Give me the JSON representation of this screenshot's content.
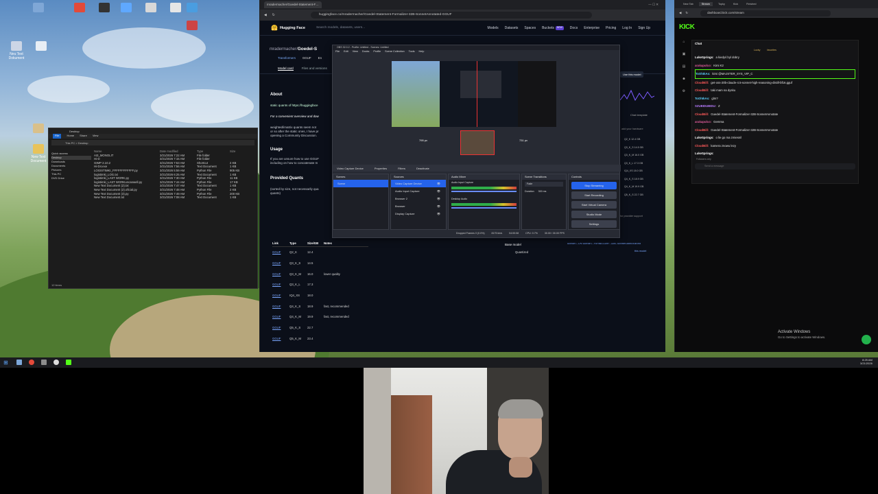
{
  "desktop": {
    "icons": [
      "Neu Text Dokument",
      "",
      "",
      "",
      "",
      "",
      "",
      "",
      "",
      "",
      "",
      "New Text Document",
      ""
    ],
    "explorer": {
      "title": "Desktop",
      "menu": [
        "File",
        "Home",
        "Share",
        "View"
      ],
      "breadcrumb": "This PC > Desktop",
      "sidebar": [
        "Quick access",
        "Desktop",
        "Downloads",
        "Documents",
        "Pictures",
        "This PC",
        "DVD Drive"
      ],
      "headers": [
        "Name",
        "Date modified",
        "Type",
        "Size"
      ],
      "files": [
        {
          "name": "AI3_MONOLIT",
          "date": "3/21/2026 7:22 AM",
          "type": "File folder",
          "size": ""
        },
        {
          "name": "Hi-D",
          "date": "3/21/2026 7:15 AM",
          "type": "File folder",
          "size": ""
        },
        {
          "name": "GIMP 2.10.2",
          "date": "3/21/2026 7:53 AM",
          "type": "Shortcut",
          "size": "2 KB"
        },
        {
          "name": "Hi-D4.exe",
          "date": "3/21/2026 7:56 AM",
          "type": "Text Document",
          "size": "1 KB"
        },
        {
          "name": "LOGISTIMKI_FFFFFFFFFFFF.py",
          "date": "3/21/2026 5:59 AM",
          "type": "Python File",
          "size": "905 KB"
        },
        {
          "name": "logistimki_LOG.txt",
          "date": "3/21/2026 6:25 AM",
          "type": "Text Document",
          "size": "1 KB"
        },
        {
          "name": "logistimki_LAST WORK.py",
          "date": "3/21/2026 7:30 AM",
          "type": "Python File",
          "size": "11 KB"
        },
        {
          "name": "logistimki_LAST WORKuncanwell.py",
          "date": "3/21/2026 7:44 AM",
          "type": "Python File",
          "size": "17 KB"
        },
        {
          "name": "New Text Document (2).txt",
          "date": "3/21/2026 7:47 AM",
          "type": "Text Document",
          "size": "1 KB"
        },
        {
          "name": "New Text Document (2).oficial.py",
          "date": "3/21/2026 7:48 AM",
          "type": "Python File",
          "size": "2 KB"
        },
        {
          "name": "New Text Document (3).py",
          "date": "3/21/2026 7:49 AM",
          "type": "Python File",
          "size": "200 KB"
        },
        {
          "name": "New Text Document.txt",
          "date": "3/21/2026 7:08 AM",
          "type": "Text Document",
          "size": "1 KB"
        }
      ],
      "status": "12 items"
    }
  },
  "browser": {
    "tab_title": "mradermacher/Goedel-Statement-Formalizer-32B-SonnetAnnotated-GGUF",
    "url": "huggingface.co/mradermacher/Goedel-Statement-Formalizer-32B-SonnetAnnotated-GGUF",
    "brand": "Hugging Face",
    "search_placeholder": "Search models, datasets, users...",
    "nav": [
      "Models",
      "Datasets",
      "Spaces",
      "Buckets",
      "Docs",
      "Enterprise",
      "Pricing",
      "Log In",
      "Sign Up"
    ],
    "buckets_badge": "NEW",
    "repo_owner": "mradermacher/",
    "repo_name": "Goedel-S",
    "tags": [
      "Transformers",
      "GGUF",
      "En"
    ],
    "tabs": [
      "Model card",
      "Files and versions"
    ],
    "about": "About",
    "about_text": "static quants of https://huggingface",
    "convenient": "For a convenient overview and dow",
    "weighted": "weighted/imatrix quants seem not",
    "weighted2": "or so after the static ones, I have pr",
    "weighted3": "opening a Community Discussion.",
    "usage": "Usage",
    "usage_text": "If you are unsure how to use GGUF",
    "usage_text2": "including on how to concatenate m",
    "provided": "Provided Quants",
    "sorted": "(sorted by size, not necessarily qua",
    "sorted2": "quants)",
    "table_headers": [
      "Link",
      "Type",
      "Size/GB",
      "Notes"
    ],
    "table": [
      {
        "link": "GGUF",
        "type": "Q2_K",
        "size": "12.4",
        "notes": ""
      },
      {
        "link": "GGUF",
        "type": "Q3_K_S",
        "size": "14.5",
        "notes": ""
      },
      {
        "link": "GGUF",
        "type": "Q3_K_M",
        "size": "16.0",
        "notes": "lower quality"
      },
      {
        "link": "GGUF",
        "type": "Q3_K_L",
        "size": "17.3",
        "notes": ""
      },
      {
        "link": "GGUF",
        "type": "IQ4_XS",
        "size": "18.0",
        "notes": ""
      },
      {
        "link": "GGUF",
        "type": "Q4_K_S",
        "size": "18.9",
        "notes": "fast, recommended"
      },
      {
        "link": "GGUF",
        "type": "Q4_K_M",
        "size": "19.9",
        "notes": "fast, recommended"
      },
      {
        "link": "GGUF",
        "type": "Q5_K_S",
        "size": "22.7",
        "notes": ""
      },
      {
        "link": "GGUF",
        "type": "Q5_K_M",
        "size": "23.4",
        "notes": ""
      }
    ],
    "use_model": "Use this model",
    "chat_template": "Chat template",
    "hardware": "add your hardware",
    "provider_support": "for provider support",
    "base_model_label": "Base model",
    "base_model": "Goedel-LM/Goedel-Formalizer-32B-SonnetAnnotated",
    "quantized": "Quantized",
    "quantized_link": "this model",
    "side_quants": [
      "Q2_K 12.4 GB",
      "Q3_K_S 14.5 GB",
      "Q3_K_M 16.0 GB",
      "Q3_K_L 17.3 GB",
      "IQ4_XS 18.0 GB",
      "Q4_K_S 18.9 GB",
      "Q4_K_M 19.9 GB",
      "Q5_K_S 22.7 GB"
    ]
  },
  "obs": {
    "title": "OBS 32.0.2 - Profile: Untitled - Scenes: Untitled",
    "menu": [
      "File",
      "Edit",
      "View",
      "Docks",
      "Profile",
      "Scene Collection",
      "Tools",
      "Help"
    ],
    "preview_labels": [
      "795 px",
      "731 px",
      "804 px"
    ],
    "source_toolbar": [
      "Video Capture Device",
      "Properties",
      "Filters",
      "Deactivate"
    ],
    "panels": [
      "Scenes",
      "Sources",
      "Audio Mixer",
      "Scene Transitions",
      "Controls"
    ],
    "scenes": [
      "Scene"
    ],
    "sources": [
      "Video Capture Device",
      "Audio Input Capture",
      "Browser 2",
      "Browser",
      "Display Capture"
    ],
    "mixer": [
      "Audio Input Capture",
      "Desktop Audio"
    ],
    "transition": "Fade",
    "duration_label": "Duration",
    "duration": "300 ms",
    "controls": [
      "Stop Streaming",
      "Start Recording",
      "Start Virtual Camera",
      "Studio Mode",
      "Settings"
    ],
    "status": [
      "Dropped Frames 0 (0.0%)",
      "8175 kb/s",
      "04:00:08",
      "CPU: 0.7%",
      "30.00 / 30.00 FPS"
    ]
  },
  "right": {
    "tabs": [
      "New Tab",
      "Stream",
      "Topky",
      "Kick",
      "Finished"
    ],
    "url": "dashboard.kick.com/stream",
    "logo": "KICK",
    "chat_title": "Chat",
    "pinned": [
      "Lucky",
      "favorites"
    ],
    "messages": [
      {
        "user": "LukeSprings:",
        "text": "a kiedyś byl dobry",
        "color": "#ffffff"
      },
      {
        "user": "arakapulco:",
        "text": "Kimi K2",
        "color": "#e25c9c"
      },
      {
        "user": "ToOhIkAs:",
        "text": "kimi @MAJSTER_SYS_VIP_C",
        "color": "#5cd2ff"
      },
      {
        "user": "CloudBill:",
        "text": "get-oss-20b-claude-4.5-sonnet-high-reasoning-distill-bf16.gguf",
        "color": "#ff5a5a"
      },
      {
        "user": "CloudBill:",
        "text": "taki mam na dysku",
        "color": "#ff5a5a"
      },
      {
        "user": "ToOhIkAs:",
        "text": "glm?",
        "color": "#5cd2ff"
      },
      {
        "user": "SZUBIDUBIDU:",
        "text": "Z",
        "color": "#b97cff"
      },
      {
        "user": "CloudBill:",
        "text": "Goedel-Statement-Formalizer-32B-SonnetAnnotate",
        "color": "#ff5a5a"
      },
      {
        "user": "arakapulco:",
        "text": "Gemma",
        "color": "#e25c9c"
      },
      {
        "user": "CloudBill:",
        "text": "Goedel-Statement-Formalizer-32B-SonnetAnnotate",
        "color": "#ff5a5a"
      },
      {
        "user": "LukeSprings:",
        "text": "o lie go ma zmiesnil",
        "color": "#ffffff"
      },
      {
        "user": "CloudBill:",
        "text": "kamera znowu lezy",
        "color": "#ff5a5a"
      },
      {
        "user": "LukeSprings:",
        "text": "",
        "color": "#ffffff"
      }
    ],
    "followers_only": "Followers only",
    "send_placeholder": "Send a message",
    "activate_title": "Activate Windows",
    "activate_sub": "Go to Settings to activate Windows."
  },
  "taskbar": {
    "time": "8:25 AM",
    "date": "3/21/2026"
  },
  "colors": {
    "accent_blue": "#2a6ef0",
    "hf_yellow": "#ffd21e",
    "kick_green": "#53fc18",
    "obs_active": "#2563eb",
    "record_red": "#e12626"
  }
}
